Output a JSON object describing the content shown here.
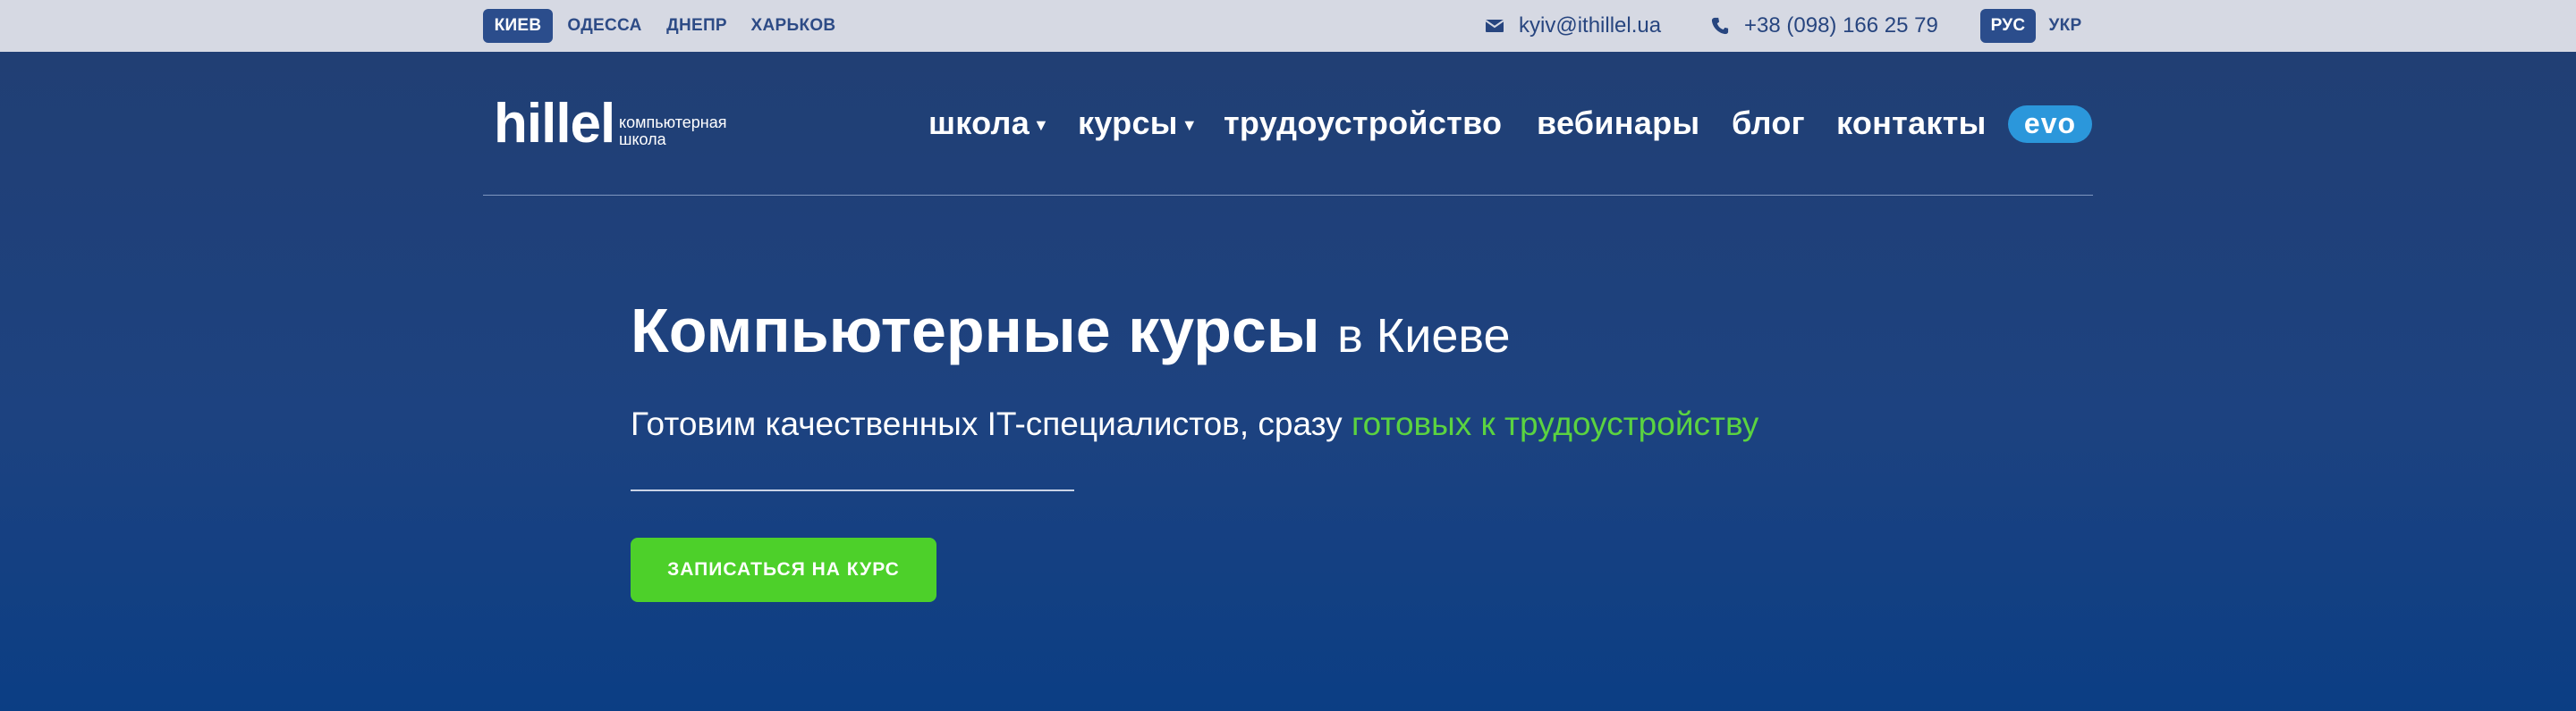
{
  "topbar": {
    "cities": [
      "КИЕВ",
      "ОДЕССА",
      "ДНЕПР",
      "ХАРЬКОВ"
    ],
    "active_city": "КИЕВ",
    "email": "kyiv@ithillel.ua",
    "phone": "+38 (098) 166 25 79",
    "languages": [
      "РУС",
      "УКР"
    ],
    "active_language": "РУС"
  },
  "header": {
    "logo": {
      "word": "hillel",
      "subtitle_line1": "компьютерная",
      "subtitle_line2": "школа"
    },
    "nav": [
      {
        "label": "школа",
        "icon": "chevron-down-icon"
      },
      {
        "label": "курсы",
        "icon": "chevron-down-icon"
      },
      {
        "label": "трудоустройство"
      },
      {
        "label": "вебинары"
      },
      {
        "label": "блог"
      },
      {
        "label": "контакты"
      }
    ],
    "evo_badge": "evo"
  },
  "hero": {
    "title_bold": "Компьютерные курсы",
    "title_light": "в Киеве",
    "subtitle_start": "Готовим качественных IT-специалистов, сразу",
    "subtitle_highlight": "готовых к трудоустройству",
    "cta_label": "ЗАПИСАТЬСЯ НА КУРС"
  },
  "colors": {
    "topbar_bg": "#d6d9e3",
    "hero_bg": "#1d4280",
    "accent_green": "#4dd02a",
    "active_pill": "#2b4d8c",
    "evo_blue": "#2b97db"
  }
}
